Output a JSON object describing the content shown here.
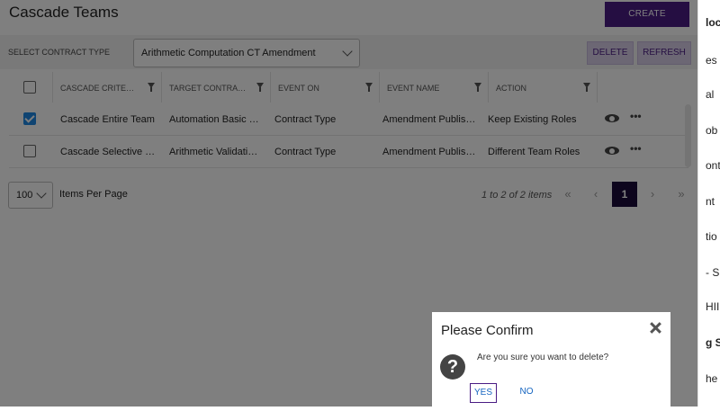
{
  "page": {
    "title": "Cascade Teams",
    "create_label": "CREATE",
    "contract_type_label": "SELECT CONTRACT TYPE",
    "contract_type_value": "Arithmetic Computation CT Amendment",
    "delete_label": "DELETE",
    "refresh_label": "REFRESH"
  },
  "table": {
    "columns": [
      "CASCADE CRITE…",
      "TARGET CONTRA…",
      "EVENT ON",
      "EVENT NAME",
      "ACTION"
    ],
    "rows": [
      {
        "checked": true,
        "criteria": "Cascade Entire Team",
        "target": "Automation Basic …",
        "event_on": "Contract Type",
        "event_name": "Amendment Publis…",
        "action": "Keep Existing Roles"
      },
      {
        "checked": false,
        "criteria": "Cascade Selective …",
        "target": "Arithmetic Validati…",
        "event_on": "Contract Type",
        "event_name": "Amendment Publis…",
        "action": "Different Team Roles"
      }
    ]
  },
  "pager": {
    "page_size": "100",
    "items_per_page_label": "Items Per Page",
    "range_text": "1 to 2 of 2 items",
    "current_page": "1"
  },
  "right_panel": {
    "items": [
      "loc",
      "es",
      "al",
      "ob",
      "ont",
      "nt",
      "tio",
      "- S",
      "HII",
      "g S",
      "he"
    ]
  },
  "dialog": {
    "title": "Please Confirm",
    "message": "Are you sure you want to delete?",
    "yes_label": "YES",
    "no_label": "NO"
  },
  "icons": {
    "view": "eye-icon",
    "more": "more-horizontal-icon",
    "filter": "filter-icon",
    "confirm": "question-circle-icon",
    "close": "close-icon"
  },
  "colors": {
    "primary": "#4a1c84",
    "checkbox_checked": "#1e88e5",
    "link": "#1565c0",
    "active_page": "#1a0b3a"
  }
}
